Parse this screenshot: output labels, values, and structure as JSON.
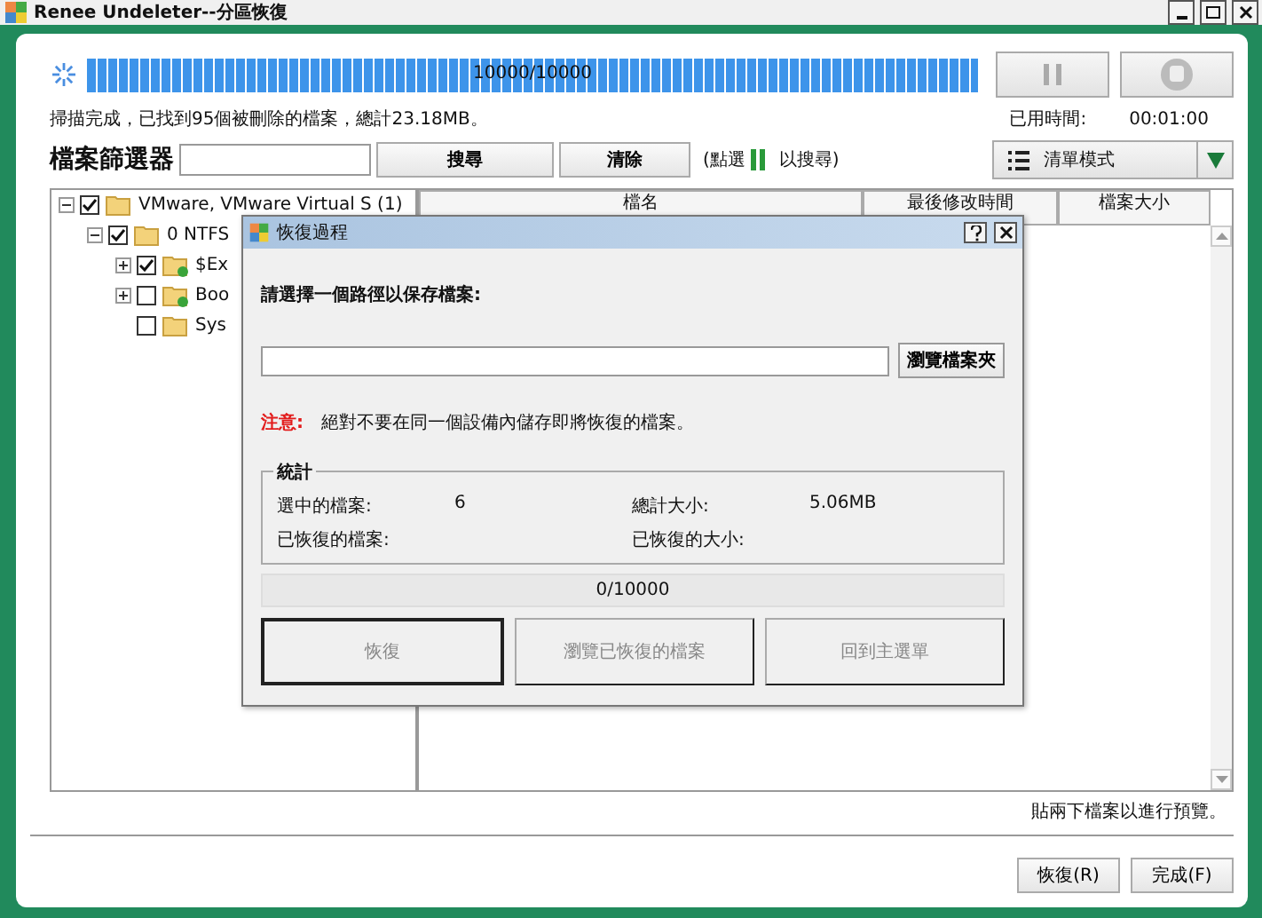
{
  "window": {
    "title": "Renee Undeleter--分區恢復"
  },
  "scan": {
    "level": 1,
    "progress_text": "10000/10000",
    "status": "掃描完成，已找到95個被刪除的檔案，總計23.18MB。",
    "elapsed_label": "已用時間:",
    "elapsed": "00:01:00"
  },
  "filter": {
    "label": "檔案篩選器",
    "search_button": "搜尋",
    "clear_button": "清除",
    "hint_prefix": "(點選",
    "hint_suffix": "以搜尋)"
  },
  "view_mode": {
    "label": "清單模式"
  },
  "tree": [
    {
      "label": "VMware, VMware Virtual S (1)",
      "checked": true,
      "expanded": true,
      "children": [
        {
          "label": "0 NTFS",
          "checked": true,
          "expanded": true,
          "children": [
            {
              "label": "$Ex",
              "checked": true,
              "expanded": false,
              "kind": "found"
            },
            {
              "label": "Boo",
              "checked": false,
              "expanded": false,
              "kind": "found"
            },
            {
              "label": "Sys",
              "checked": false,
              "kind": "plain"
            }
          ]
        }
      ]
    }
  ],
  "table": {
    "columns": [
      "檔名",
      "最後修改時間",
      "檔案大小"
    ]
  },
  "footer": {
    "hint": "貼兩下檔案以進行預覽。",
    "buttons": [
      "恢復(R)",
      "完成(F)"
    ]
  },
  "dialog": {
    "title": "恢復過程",
    "prompt": "請選擇一個路徑以保存檔案:",
    "browse_button": "瀏覽檔案夾",
    "warning_label": "注意:",
    "warning": "絕對不要在同一個設備內儲存即將恢復的檔案。",
    "stats_title": "統計",
    "stats": [
      {
        "label": "選中的檔案:",
        "value": "6"
      },
      {
        "label": "總計大小:",
        "value": "5.06MB"
      },
      {
        "label": "已恢復的檔案:"
      },
      {
        "label": "已恢復的大小:"
      }
    ],
    "level": 0,
    "progress_text": "0/10000",
    "buttons": [
      {
        "label": "恢復",
        "disabled": true,
        "default": true
      },
      {
        "label": "瀏覽已恢復的檔案",
        "disabled": true,
        "default": false
      },
      {
        "label": "回到主選單",
        "disabled": true,
        "default": false
      }
    ]
  }
}
